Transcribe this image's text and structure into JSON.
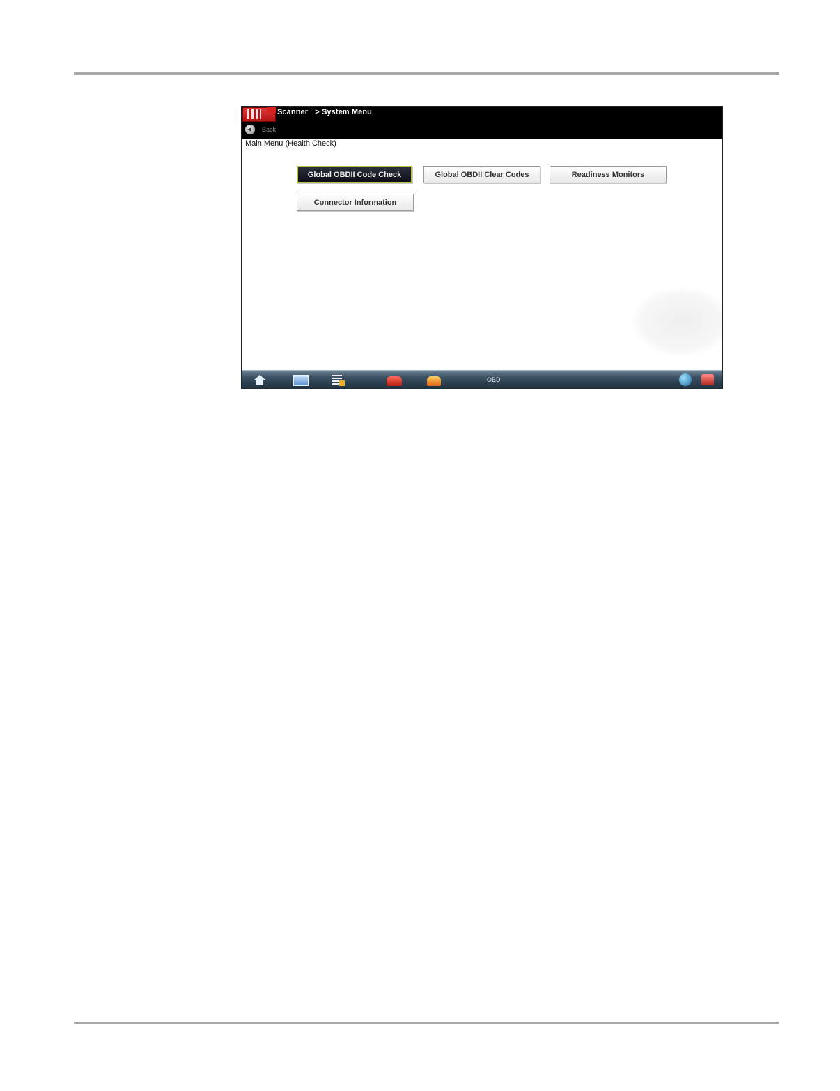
{
  "header": {
    "breadcrumb": [
      "Scanner",
      "> System Menu"
    ],
    "back_label": "Back"
  },
  "main": {
    "heading": "Main Menu (Health Check)",
    "buttons": [
      {
        "label": "Global OBDII Code Check",
        "selected": true
      },
      {
        "label": "Global OBDII Clear Codes",
        "selected": false
      },
      {
        "label": "Readiness Monitors",
        "selected": false
      },
      {
        "label": "Connector Information",
        "selected": false
      }
    ]
  },
  "taskbar": {
    "icons": [
      "home-icon",
      "screen-icon",
      "list-icon",
      "car-red-icon",
      "car-orange-icon",
      "globe-icon",
      "camera-icon"
    ],
    "status_text": "OBD"
  },
  "colors": {
    "titlebar": "#000000",
    "selected_button": "#0c0f16",
    "selected_border": "#b8c24a",
    "taskbar": "#3b5163"
  }
}
